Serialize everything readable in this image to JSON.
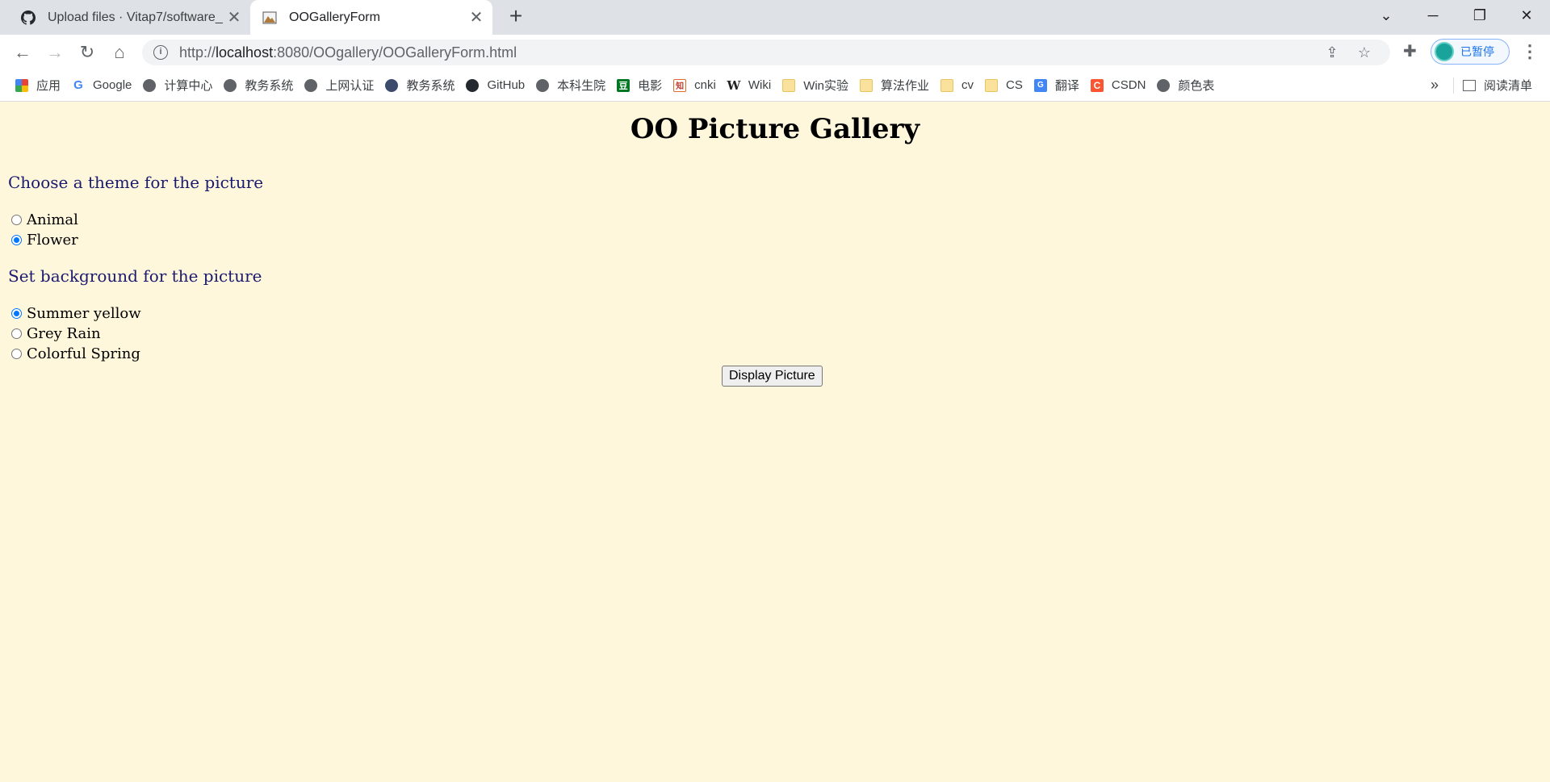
{
  "browser": {
    "tabs": [
      {
        "title": "Upload files · Vitap7/software_",
        "active": false,
        "icon": "github-icon"
      },
      {
        "title": "OOGalleryForm",
        "active": true,
        "icon": "image-icon"
      }
    ],
    "url_scheme": "http://",
    "url_host": "localhost",
    "url_rest": ":8080/OOgallery/OOGalleryForm.html",
    "profile_label": "已暂停",
    "bookmarks": [
      {
        "label": "应用",
        "icon": "apps-grid-icon"
      },
      {
        "label": "Google",
        "icon": "google-icon"
      },
      {
        "label": "计算中心",
        "icon": "globe-icon"
      },
      {
        "label": "教务系统",
        "icon": "globe-icon"
      },
      {
        "label": "上网认证",
        "icon": "globe-icon"
      },
      {
        "label": "教务系统",
        "icon": "university-icon"
      },
      {
        "label": "GitHub",
        "icon": "github-icon"
      },
      {
        "label": "本科生院",
        "icon": "globe-icon"
      },
      {
        "label": "电影",
        "icon": "douban-icon"
      },
      {
        "label": "cnki",
        "icon": "cnki-icon"
      },
      {
        "label": "Wiki",
        "icon": "wikipedia-icon"
      },
      {
        "label": "Win实验",
        "icon": "folder-icon"
      },
      {
        "label": "算法作业",
        "icon": "folder-icon"
      },
      {
        "label": "cv",
        "icon": "folder-icon"
      },
      {
        "label": "CS",
        "icon": "folder-icon"
      },
      {
        "label": "翻译",
        "icon": "translate-icon"
      },
      {
        "label": "CSDN",
        "icon": "csdn-icon"
      },
      {
        "label": "颜色表",
        "icon": "globe-icon"
      }
    ],
    "more_label": "»",
    "reading_list_label": "阅读清单"
  },
  "page": {
    "background_color": "#fff7dc",
    "title": "OO Picture Gallery",
    "theme_heading": "Choose a theme for the picture",
    "themes": [
      {
        "label": "Animal",
        "checked": false
      },
      {
        "label": "Flower",
        "checked": true
      }
    ],
    "background_heading": "Set background for the picture",
    "backgrounds": [
      {
        "label": "Summer yellow",
        "checked": true
      },
      {
        "label": "Grey Rain",
        "checked": false
      },
      {
        "label": "Colorful Spring",
        "checked": false
      }
    ],
    "submit_label": "Display Picture"
  }
}
